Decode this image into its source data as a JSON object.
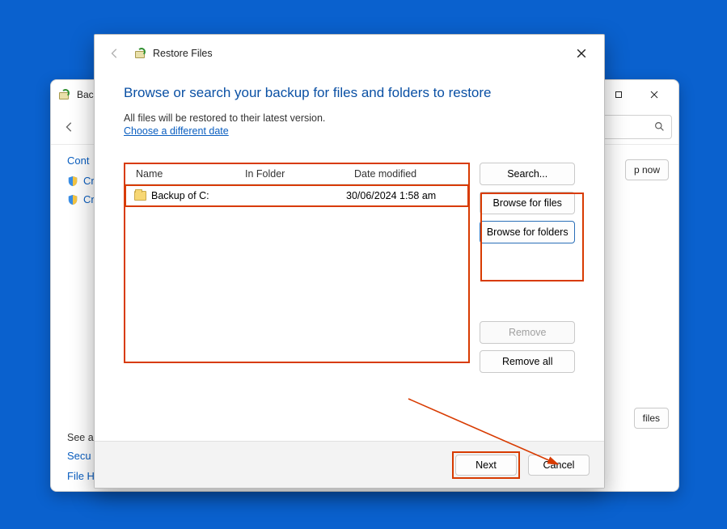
{
  "parent": {
    "title": "Back",
    "sidebar": {
      "control": "Cont",
      "create1": "Creat",
      "create2": "Creat",
      "see_label": "See a",
      "security": "Secu",
      "filehist": "File H"
    },
    "btn_now": "p now",
    "btn_files": "files"
  },
  "dialog": {
    "title": "Restore Files",
    "heading": "Browse or search your backup for files and folders to restore",
    "subtext": "All files will be restored to their latest version.",
    "link": "Choose a different date",
    "columns": {
      "name": "Name",
      "folder": "In Folder",
      "date": "Date modified"
    },
    "rows": [
      {
        "name": "Backup of C:",
        "folder": "",
        "date": "30/06/2024 1:58 am"
      }
    ],
    "buttons": {
      "search": "Search...",
      "browse_files": "Browse for files",
      "browse_folders": "Browse for folders",
      "remove": "Remove",
      "remove_all": "Remove all"
    },
    "footer": {
      "next": "Next",
      "cancel": "Cancel"
    }
  }
}
